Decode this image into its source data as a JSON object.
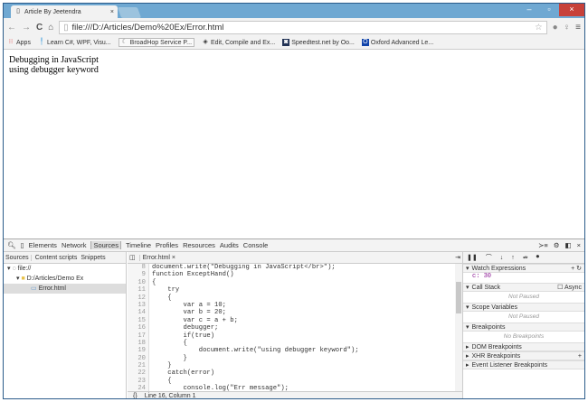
{
  "browser": {
    "tab_title": "Article By Jeetendra",
    "tab_close": "×",
    "url": "file:///D:/Articles/Demo%20Ex/Error.html",
    "window_controls": {
      "minimize": "–",
      "maximize": "▫",
      "close": "×"
    },
    "bookmarks": [
      "Apps",
      "Learn C#, WPF, Visu...",
      "BroadHop Service P...",
      "Edit, Compile and Ex...",
      "Speedtest.net by Oo...",
      "Oxford Advanced Le..."
    ]
  },
  "page": {
    "lines": [
      "Debugging in JavaScript",
      "using debugger keyword"
    ]
  },
  "devtools": {
    "tabs": [
      "Elements",
      "Network",
      "Sources",
      "Timeline",
      "Profiles",
      "Resources",
      "Audits",
      "Console"
    ],
    "nav_tabs": [
      "Sources",
      "Content scripts",
      "Snippets"
    ],
    "tree": [
      "file://",
      "D:/Articles/Demo Ex",
      "Error.html"
    ],
    "file_tab": "Error.html ×",
    "code": [
      {
        "n": "8",
        "t": "document.write(\"Debugging in JavaScript</br>\");"
      },
      {
        "n": "9",
        "t": "function ExceptHand()"
      },
      {
        "n": "10",
        "t": "{"
      },
      {
        "n": "11",
        "t": "    try"
      },
      {
        "n": "12",
        "t": "    {"
      },
      {
        "n": "13",
        "t": "        var a = 10;"
      },
      {
        "n": "14",
        "t": "        var b = 20;"
      },
      {
        "n": "15",
        "t": "        var c = a + b;"
      },
      {
        "n": "16",
        "t": "        debugger;"
      },
      {
        "n": "17",
        "t": "        if(true)"
      },
      {
        "n": "18",
        "t": "        {"
      },
      {
        "n": "19",
        "t": "            document.write(\"using debugger keyword\");"
      },
      {
        "n": "20",
        "t": "        }"
      },
      {
        "n": "21",
        "t": "    }"
      },
      {
        "n": "22",
        "t": "    catch(error)"
      },
      {
        "n": "23",
        "t": "    {"
      },
      {
        "n": "24",
        "t": "        console.log(\"Err message\");"
      }
    ],
    "status": {
      "braces": "{}",
      "position": "Line 16, Column 1"
    },
    "sidebar": {
      "watch": "Watch Expressions",
      "watch_value": "c: 30",
      "call_stack": "Call Stack",
      "async": "Async",
      "not_paused": "Not Paused",
      "scope": "Scope Variables",
      "breakpoints": "Breakpoints",
      "no_breakpoints": "No Breakpoints",
      "dom": "DOM Breakpoints",
      "xhr": "XHR Breakpoints",
      "event": "Event Listener Breakpoints"
    }
  }
}
